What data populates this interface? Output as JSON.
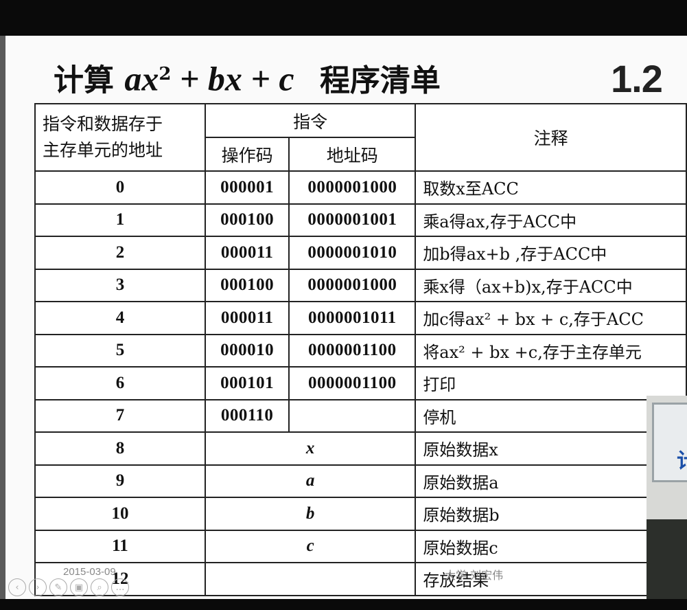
{
  "slide": {
    "title_prefix": "计算",
    "title_math_1": "ax",
    "title_sup": "2",
    "title_math_2": " + bx + c",
    "title_suffix": "程序清单",
    "badge": "1.2",
    "footer_date": "2015-03-09",
    "footer_author": "大学  刘宏伟"
  },
  "table": {
    "header": {
      "addr_line1": "指令和数据存于",
      "addr_line2": "主存单元的地址",
      "instr": "指令",
      "opcode": "操作码",
      "addrcode": "地址码",
      "note": "注释"
    },
    "rows": [
      {
        "addr": "0",
        "op": "000001",
        "ad": "0000001000",
        "note": "取数x至ACC"
      },
      {
        "addr": "1",
        "op": "000100",
        "ad": "0000001001",
        "note": "乘a得ax,存于ACC中"
      },
      {
        "addr": "2",
        "op": "000011",
        "ad": "0000001010",
        "note": "加b得ax+b ,存于ACC中"
      },
      {
        "addr": "3",
        "op": "000100",
        "ad": "0000001000",
        "note": "乘x得（ax+b)x,存于ACC中"
      },
      {
        "addr": "4",
        "op": "000011",
        "ad": "0000001011",
        "note": "加c得ax² + bx + c,存于ACC"
      },
      {
        "addr": "5",
        "op": "000010",
        "ad": "0000001100",
        "note": "将ax² + bx +c,存于主存单元"
      },
      {
        "addr": "6",
        "op": "000101",
        "ad": "0000001100",
        "note": "打印"
      },
      {
        "addr": "7",
        "op": "000110",
        "ad": "",
        "note": "停机"
      }
    ],
    "data_rows": [
      {
        "addr": "8",
        "val": "x",
        "note": "原始数据x"
      },
      {
        "addr": "9",
        "val": "a",
        "note": "原始数据a"
      },
      {
        "addr": "10",
        "val": "b",
        "note": "原始数据b"
      },
      {
        "addr": "11",
        "val": "c",
        "note": "原始数据c"
      },
      {
        "addr": "12",
        "val": "",
        "note": "存放结果"
      }
    ]
  },
  "controls": [
    "‹",
    "›",
    "✎",
    "▣",
    "⌕",
    "…"
  ],
  "webcam": {
    "glyph": "计"
  }
}
